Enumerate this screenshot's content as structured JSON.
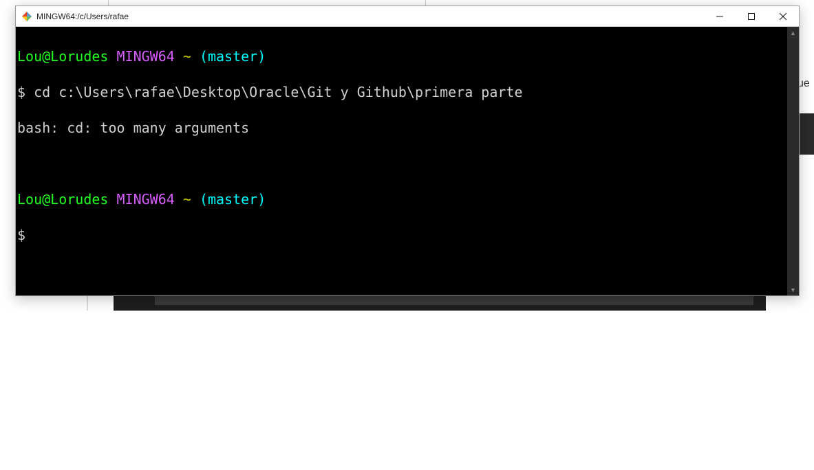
{
  "window": {
    "title": "MINGW64:/c/Users/rafae"
  },
  "bg": {
    "right_fragment": "ue"
  },
  "terminal": {
    "prompt1": {
      "user": "Lou@Lorudes",
      "host": "MINGW64",
      "tilde": "~",
      "branch": "(master)"
    },
    "command1": {
      "dollar": "$",
      "text": "cd c:\\Users\\rafae\\Desktop\\Oracle\\Git y Github\\primera parte"
    },
    "error1": "bash: cd: too many arguments",
    "prompt2": {
      "user": "Lou@Lorudes",
      "host": "MINGW64",
      "tilde": "~",
      "branch": "(master)"
    },
    "command2": {
      "dollar": "$",
      "text": ""
    }
  }
}
